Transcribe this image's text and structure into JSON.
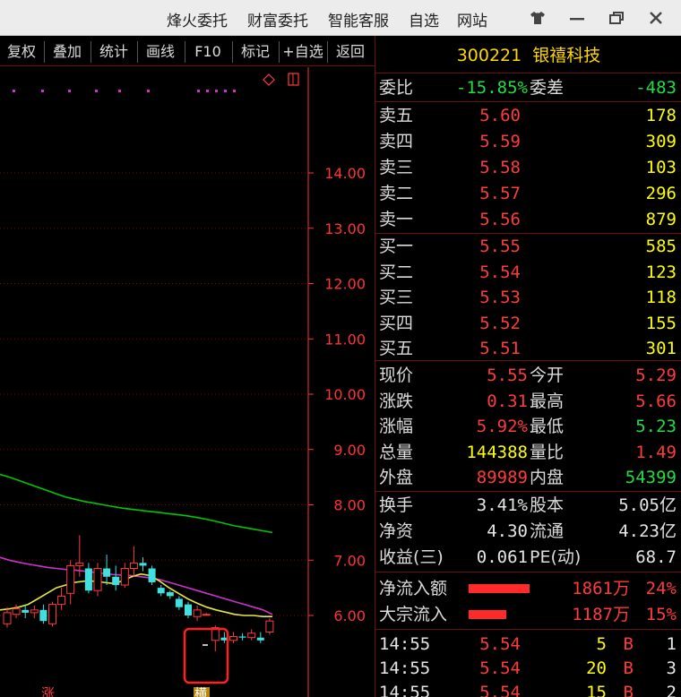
{
  "titlebar": {
    "menu": [
      "烽火委托",
      "财富委托",
      "智能客服",
      "自选",
      "网站"
    ],
    "icons": [
      "shirt-icon",
      "minimize-icon",
      "restore-icon",
      "close-icon"
    ]
  },
  "toolbar": {
    "buttons": [
      "复权",
      "叠加",
      "统计",
      "画线",
      "F10",
      "标记",
      "+自选",
      "返回"
    ]
  },
  "chart": {
    "y_ticks": [
      "14.00",
      "13.00",
      "12.00",
      "11.00",
      "10.00",
      "9.00",
      "8.00",
      "7.00",
      "6.00"
    ],
    "bottom_marks": [
      "涨",
      "横"
    ],
    "colors": {
      "grid": "#8b0000",
      "axis": "#ff3333",
      "ma_green": "#00c800",
      "ma_magenta": "#cc33cc",
      "ma_yellow": "#e8e840",
      "highlight": "#ff2020"
    }
  },
  "chart_data": {
    "type": "candlestick",
    "ylim": [
      5.5,
      14.6
    ],
    "y_ticks": [
      14,
      13,
      12,
      11,
      10,
      9,
      8,
      7,
      6
    ],
    "candles": [
      {
        "o": 5.85,
        "c": 6.05,
        "h": 6.15,
        "l": 5.78
      },
      {
        "o": 6.02,
        "c": 6.12,
        "h": 6.2,
        "l": 5.95
      },
      {
        "o": 6.1,
        "c": 6.05,
        "h": 6.2,
        "l": 5.95
      },
      {
        "o": 6.05,
        "c": 6.1,
        "h": 6.18,
        "l": 5.95
      },
      {
        "o": 6.1,
        "c": 5.9,
        "h": 6.2,
        "l": 5.85
      },
      {
        "o": 5.85,
        "c": 6.2,
        "h": 6.25,
        "l": 5.8
      },
      {
        "o": 6.2,
        "c": 6.35,
        "h": 6.5,
        "l": 6.1
      },
      {
        "o": 6.4,
        "c": 6.9,
        "h": 7.0,
        "l": 6.2
      },
      {
        "o": 6.9,
        "c": 6.95,
        "h": 7.45,
        "l": 6.7
      },
      {
        "o": 6.85,
        "c": 6.45,
        "h": 6.95,
        "l": 6.4
      },
      {
        "o": 6.45,
        "c": 6.85,
        "h": 6.95,
        "l": 6.35
      },
      {
        "o": 6.85,
        "c": 6.7,
        "h": 7.1,
        "l": 6.55
      },
      {
        "o": 6.7,
        "c": 6.55,
        "h": 6.9,
        "l": 6.45
      },
      {
        "o": 6.55,
        "c": 6.85,
        "h": 6.95,
        "l": 6.5
      },
      {
        "o": 6.85,
        "c": 6.95,
        "h": 7.25,
        "l": 6.7
      },
      {
        "o": 6.95,
        "c": 6.9,
        "h": 7.05,
        "l": 6.8
      },
      {
        "o": 6.85,
        "c": 6.6,
        "h": 6.9,
        "l": 6.55
      },
      {
        "o": 6.5,
        "c": 6.4,
        "h": 6.55,
        "l": 6.35
      },
      {
        "o": 6.42,
        "c": 6.35,
        "h": 6.45,
        "l": 6.3
      },
      {
        "o": 6.3,
        "c": 6.15,
        "h": 6.35,
        "l": 6.1
      },
      {
        "o": 6.2,
        "c": 6.0,
        "h": 6.25,
        "l": 5.95
      },
      {
        "o": 5.98,
        "c": 6.1,
        "h": 6.18,
        "l": 5.9
      },
      {
        "o": 6.02,
        "c": 6.02,
        "h": 6.05,
        "l": 6.0
      },
      {
        "o": 5.55,
        "c": 5.78,
        "h": 5.82,
        "l": 5.35
      },
      {
        "o": 5.6,
        "c": 5.55,
        "h": 5.7,
        "l": 5.5
      },
      {
        "o": 5.55,
        "c": 5.62,
        "h": 5.7,
        "l": 5.5
      },
      {
        "o": 5.62,
        "c": 5.6,
        "h": 5.68,
        "l": 5.55
      },
      {
        "o": 5.6,
        "c": 5.68,
        "h": 5.75,
        "l": 5.55
      },
      {
        "o": 5.6,
        "c": 5.55,
        "h": 5.7,
        "l": 5.5
      },
      {
        "o": 5.7,
        "c": 5.9,
        "h": 5.95,
        "l": 5.65
      }
    ],
    "ma_green": [
      8.55,
      8.5,
      8.44,
      8.38,
      8.32,
      8.26,
      8.2,
      8.14,
      8.1,
      8.06,
      8.03,
      8.0,
      7.97,
      7.94,
      7.92,
      7.9,
      7.88,
      7.86,
      7.84,
      7.82,
      7.8,
      7.77,
      7.74,
      7.7,
      7.66,
      7.62,
      7.59,
      7.56,
      7.53,
      7.5
    ],
    "ma_magenta": [
      7.05,
      7.0,
      6.96,
      6.93,
      6.9,
      6.87,
      6.85,
      6.83,
      6.82,
      6.8,
      6.78,
      6.76,
      6.74,
      6.73,
      6.72,
      6.7,
      6.68,
      6.65,
      6.6,
      6.55,
      6.5,
      6.45,
      6.4,
      6.35,
      6.3,
      6.25,
      6.2,
      6.15,
      6.1,
      6.02
    ],
    "ma_yellow": [
      6.1,
      6.12,
      6.15,
      6.2,
      6.3,
      6.4,
      6.5,
      6.55,
      6.6,
      6.62,
      6.62,
      6.6,
      6.58,
      6.62,
      6.7,
      6.75,
      6.72,
      6.62,
      6.5,
      6.4,
      6.3,
      6.22,
      6.15,
      6.1,
      6.06,
      6.02,
      6.0,
      6.0,
      5.98,
      5.98
    ]
  },
  "quote": {
    "code": "300221",
    "name": "银禧科技",
    "weibi": {
      "label": "委比",
      "value": "-15.85%",
      "label2": "委差",
      "value2": "-483"
    },
    "asks": [
      {
        "label": "卖五",
        "price": "5.60",
        "vol": "178"
      },
      {
        "label": "卖四",
        "price": "5.59",
        "vol": "309"
      },
      {
        "label": "卖三",
        "price": "5.58",
        "vol": "103"
      },
      {
        "label": "卖二",
        "price": "5.57",
        "vol": "296"
      },
      {
        "label": "卖一",
        "price": "5.56",
        "vol": "879"
      }
    ],
    "bids": [
      {
        "label": "买一",
        "price": "5.55",
        "vol": "585"
      },
      {
        "label": "买二",
        "price": "5.54",
        "vol": "123"
      },
      {
        "label": "买三",
        "price": "5.53",
        "vol": "118"
      },
      {
        "label": "买四",
        "price": "5.52",
        "vol": "155"
      },
      {
        "label": "买五",
        "price": "5.51",
        "vol": "301"
      }
    ],
    "stats": [
      {
        "l1": "现价",
        "v1": "5.55",
        "l2": "今开",
        "v2": "5.29"
      },
      {
        "l1": "涨跌",
        "v1": "0.31",
        "l2": "最高",
        "v2": "5.66"
      },
      {
        "l1": "涨幅",
        "v1": "5.92%",
        "l2": "最低",
        "v2": "5.23"
      },
      {
        "l1": "总量",
        "v1": "144388",
        "l2": "量比",
        "v2": "1.49"
      },
      {
        "l1": "外盘",
        "v1": "89989",
        "l2": "内盘",
        "v2": "54399"
      }
    ],
    "fundamentals": [
      {
        "l1": "换手",
        "v1": "3.41%",
        "l2": "股本",
        "v2": "5.05亿"
      },
      {
        "l1": "净资",
        "v1": "4.30",
        "l2": "流通",
        "v2": "4.23亿"
      },
      {
        "l1": "收益(三)",
        "v1": "0.061",
        "l2": "PE(动)",
        "v2": "68.7"
      }
    ],
    "flows": [
      {
        "label": "净流入额",
        "amount": "1861万",
        "pct": "24%",
        "bar_fraction": 1.0
      },
      {
        "label": "大宗流入",
        "amount": "1187万",
        "pct": "15%",
        "bar_fraction": 0.62
      }
    ],
    "ticks": [
      {
        "time": "14:55",
        "price": "5.54",
        "vol": "5",
        "side": "B",
        "n": "1"
      },
      {
        "time": "14:55",
        "price": "5.54",
        "vol": "20",
        "side": "B",
        "n": "3"
      },
      {
        "time": "14:55",
        "price": "5.54",
        "vol": "15",
        "side": "B",
        "n": "2"
      }
    ]
  }
}
